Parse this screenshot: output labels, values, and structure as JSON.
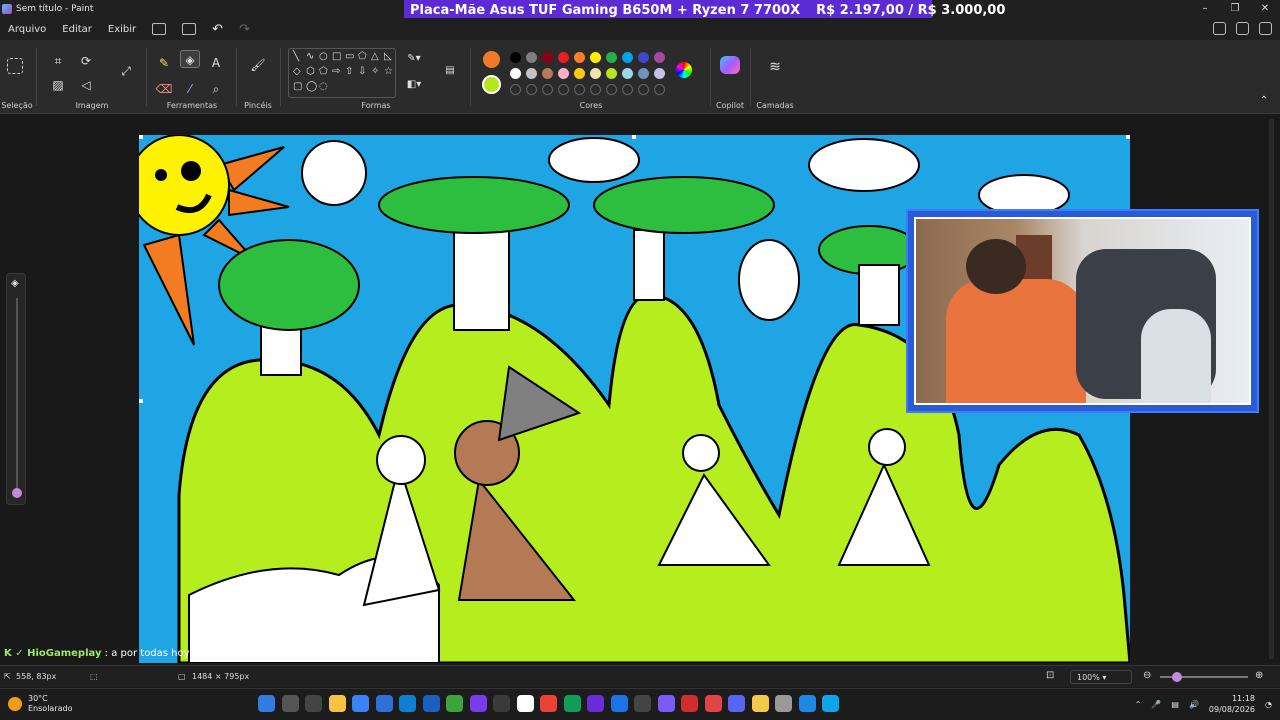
{
  "window": {
    "title": "Sem título - Paint",
    "controls": [
      "–",
      "❐",
      "✕"
    ]
  },
  "banner": {
    "product": "Placa-Mãe Asus TUF Gaming B650M + Ryzen 7 7700X",
    "price": "R$ 2.197,00 / R$ 3.000,00"
  },
  "menu": {
    "items": [
      "Arquivo",
      "Editar",
      "Exibir"
    ]
  },
  "ribbon": {
    "groups": {
      "selection": "Seleção",
      "image": "Imagem",
      "tools": "Ferramentas",
      "brushes": "Pincéis",
      "shapes": "Formas",
      "colors": "Cores",
      "copilot": "Copilot",
      "layers": "Camadas"
    },
    "tool_glyphs": {
      "pencil": "✎",
      "fill": "◈",
      "text": "A",
      "eraser": "⌫",
      "picker": "⁄",
      "magnifier": "⌕",
      "brush": "🖌"
    },
    "shape_glyphs": [
      "╲",
      "∿",
      "○",
      "□",
      "▭",
      "⬠",
      "△",
      "◺",
      "◇",
      "⬡",
      "⬠",
      "⇨",
      "⇧",
      "⇩",
      "✧",
      "☆",
      "▢",
      "◯",
      "◌"
    ],
    "colors": {
      "primary": "#f07a27",
      "secondary": "#b5e61d",
      "palette_row1": [
        "#000000",
        "#7f7f7f",
        "#880015",
        "#ed1c24",
        "#ff7f27",
        "#fff200",
        "#22b14c",
        "#00a2e8",
        "#3f48cc",
        "#a349a4"
      ],
      "palette_row2": [
        "#ffffff",
        "#c3c3c3",
        "#b97a57",
        "#ffaec9",
        "#ffc90e",
        "#efe4b0",
        "#b5e61d",
        "#99d9ea",
        "#7092be",
        "#c8bfe7"
      ]
    }
  },
  "chat": {
    "user": "HioGameplay",
    "message": ": a por todas hoy, estamos activos"
  },
  "status": {
    "cursor_pos": "558, 83px",
    "canvas_size": "1484 × 795px",
    "zoom": "100%"
  },
  "taskbar": {
    "weather": {
      "temp": "30°C",
      "desc": "Ensolarado"
    },
    "time": "11:18",
    "date": "09/08/2026",
    "app_colors": [
      "#2f7de1",
      "#555555",
      "#444444",
      "#f5c242",
      "#3b82f6",
      "#2e6fd9",
      "#0e7fd3",
      "#1b5fc2",
      "#3ba53b",
      "#7c3aed",
      "#3a3a3a",
      "#ffffff",
      "#ea4335",
      "#0f9d58",
      "#6c2bd9",
      "#1a73e8",
      "#444444",
      "#7a5af8",
      "#d02d2d",
      "#e04444",
      "#5865f2",
      "#f2c94c",
      "#999999",
      "#1e88e5",
      "#0ea5e9"
    ]
  }
}
